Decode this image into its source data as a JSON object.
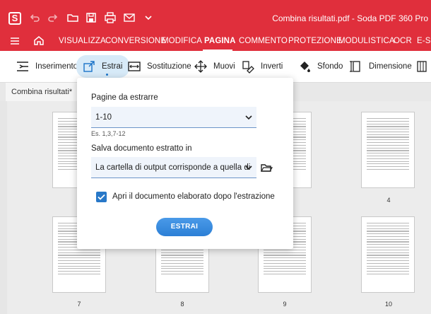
{
  "app": {
    "logo_letter": "S",
    "window_title": "Combina risultati.pdf  -  Soda PDF 360 Pro"
  },
  "menu": {
    "items": [
      "VISUALIZZA",
      "CONVERSIONE",
      "MODIFICA",
      "PAGINA",
      "COMMENTO",
      "PROTEZIONE",
      "MODULISTICA",
      "OCR",
      "E-SIG"
    ],
    "active": "PAGINA"
  },
  "toolbar": {
    "tools": [
      "Inserimento",
      "Estrai",
      "Sostituzione",
      "Muovi",
      "Inverti",
      "Sfondo",
      "Dimensione"
    ],
    "selected": "Estrai"
  },
  "tab": {
    "label": "Combina risultati*"
  },
  "popup": {
    "pages_label": "Pagine da estrarre",
    "pages_value": "1-10",
    "pages_hint": "Es. 1,3,7-12",
    "save_label": "Salva documento estratto in",
    "save_value": "La cartella di output corrisponde a quella di",
    "open_after_label": "Apri il documento elaborato dopo l'estrazione",
    "open_after_checked": true,
    "extract_button": "ESTRAI"
  },
  "pages": {
    "labels": [
      "4",
      "7",
      "8",
      "9",
      "10"
    ]
  },
  "colors": {
    "accent": "#e02f3c",
    "primary": "#2c7fd6",
    "selection": "#d7eaf8"
  }
}
